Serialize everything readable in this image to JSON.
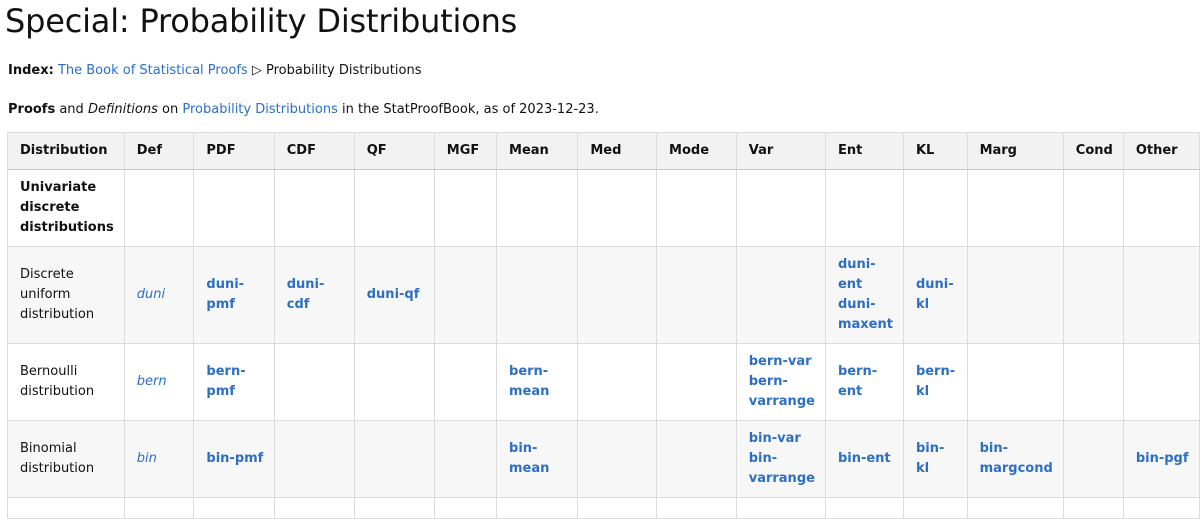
{
  "page": {
    "title": "Special: Probability Distributions",
    "index_label": "Index:",
    "index_link": "The Book of Statistical Proofs",
    "index_sep": "▷",
    "index_current": "Probability Distributions",
    "summary_proofs": "Proofs",
    "summary_and": "and",
    "summary_definitions": "Definitions",
    "summary_on": "on",
    "summary_link": "Probability Distributions",
    "summary_rest": "in the StatProofBook, as of 2023-12-23."
  },
  "table": {
    "headers": [
      "Distribution",
      "Def",
      "PDF",
      "CDF",
      "QF",
      "MGF",
      "Mean",
      "Med",
      "Mode",
      "Var",
      "Ent",
      "KL",
      "Marg",
      "Cond",
      "Other"
    ],
    "category": [
      "Univariate",
      "discrete",
      "distributions"
    ],
    "rows": [
      {
        "name": [
          "Discrete",
          "uniform",
          "distribution"
        ],
        "def": "duni",
        "pdf": [
          "duni-pmf"
        ],
        "cdf": [
          "duni-cdf"
        ],
        "qf": [
          "duni-qf"
        ],
        "mean": [],
        "var": [],
        "ent": [
          "duni-",
          "ent",
          "duni-",
          "maxent"
        ],
        "kl": [
          "duni-",
          "kl"
        ],
        "marg": [],
        "other": []
      },
      {
        "name": [
          "Bernoulli",
          "distribution"
        ],
        "def": "bern",
        "pdf": [
          "bern-",
          "pmf"
        ],
        "cdf": [],
        "qf": [],
        "mean": [
          "bern-",
          "mean"
        ],
        "var": [
          "bern-var",
          "bern-",
          "varrange"
        ],
        "ent": [
          "bern-",
          "ent"
        ],
        "kl": [
          "bern-",
          "kl"
        ],
        "marg": [],
        "other": []
      },
      {
        "name": [
          "Binomial",
          "distribution"
        ],
        "def": "bin",
        "pdf": [
          "bin-pmf"
        ],
        "cdf": [],
        "qf": [],
        "mean": [
          "bin-",
          "mean"
        ],
        "var": [
          "bin-var",
          "bin-",
          "varrange"
        ],
        "ent": [
          "bin-ent"
        ],
        "kl": [
          "bin-kl"
        ],
        "marg": [
          "bin-",
          "margcond"
        ],
        "other": [
          "bin-pgf"
        ]
      }
    ]
  },
  "colors": {
    "link": "#2c6fc4",
    "header_bg": "#f2f2f2",
    "row_alt_bg": "#f7f7f7"
  }
}
